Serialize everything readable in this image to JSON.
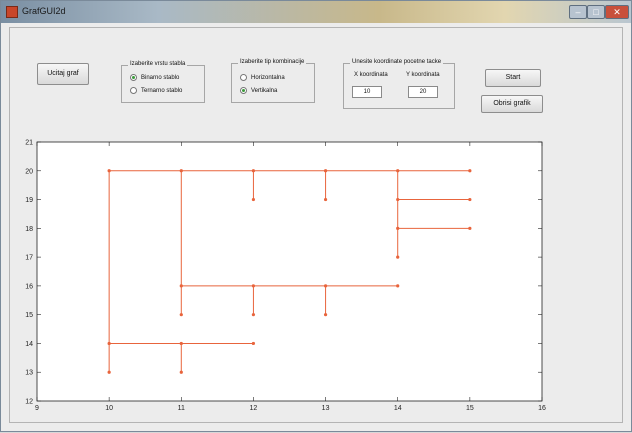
{
  "window": {
    "title": "GrafGUI2d",
    "min_label": "–",
    "max_label": "□",
    "close_label": "✕"
  },
  "buttons": {
    "load": "Ucitaj graf",
    "start": "Start",
    "clear": "Obrisi grafik"
  },
  "tree_type": {
    "title": "Izaberite vrstu stabla",
    "options": [
      {
        "label": "Binarno stablo",
        "selected": true
      },
      {
        "label": "Ternarno stablo",
        "selected": false
      }
    ]
  },
  "combo_type": {
    "title": "Izaberite tip kombinacije",
    "options": [
      {
        "label": "Horizontalna",
        "selected": false
      },
      {
        "label": "Vertikalna",
        "selected": true
      }
    ]
  },
  "coords": {
    "title": "Unesite koordinate pocetne tacke",
    "x_label": "X koordinata",
    "y_label": "Y koordinata",
    "x_value": "10",
    "y_value": "20"
  },
  "colors": {
    "line": "#e8643c",
    "axis": "#222222",
    "plot_bg": "#ffffff"
  },
  "chart_data": {
    "type": "line",
    "xlim": [
      9,
      16
    ],
    "ylim": [
      12,
      21
    ],
    "xticks": [
      "9",
      "10",
      "11",
      "12",
      "13",
      "14",
      "15",
      "16"
    ],
    "yticks": [
      "12",
      "13",
      "14",
      "15",
      "16",
      "17",
      "18",
      "19",
      "20",
      "21"
    ],
    "segments": [
      [
        [
          10,
          20
        ],
        [
          15,
          20
        ]
      ],
      [
        [
          10,
          20
        ],
        [
          10,
          13
        ]
      ],
      [
        [
          10,
          14
        ],
        [
          12,
          14
        ]
      ],
      [
        [
          11,
          20
        ],
        [
          11,
          15
        ]
      ],
      [
        [
          11,
          14
        ],
        [
          11,
          13
        ]
      ],
      [
        [
          11,
          16
        ],
        [
          14,
          16
        ]
      ],
      [
        [
          12,
          20
        ],
        [
          12,
          19
        ]
      ],
      [
        [
          12,
          16
        ],
        [
          12,
          15
        ]
      ],
      [
        [
          13,
          20
        ],
        [
          13,
          19
        ]
      ],
      [
        [
          13,
          16
        ],
        [
          13,
          15
        ]
      ],
      [
        [
          14,
          20
        ],
        [
          14,
          17
        ]
      ],
      [
        [
          14,
          19
        ],
        [
          15,
          19
        ]
      ],
      [
        [
          14,
          18
        ],
        [
          15,
          18
        ]
      ]
    ],
    "points": [
      [
        10,
        20
      ],
      [
        11,
        20
      ],
      [
        12,
        20
      ],
      [
        13,
        20
      ],
      [
        14,
        20
      ],
      [
        15,
        20
      ],
      [
        12,
        19
      ],
      [
        13,
        19
      ],
      [
        14,
        19
      ],
      [
        15,
        19
      ],
      [
        14,
        18
      ],
      [
        15,
        18
      ],
      [
        14,
        17
      ],
      [
        11,
        16
      ],
      [
        12,
        16
      ],
      [
        13,
        16
      ],
      [
        14,
        16
      ],
      [
        11,
        15
      ],
      [
        12,
        15
      ],
      [
        13,
        15
      ],
      [
        10,
        14
      ],
      [
        11,
        14
      ],
      [
        12,
        14
      ],
      [
        10,
        13
      ],
      [
        11,
        13
      ]
    ]
  }
}
